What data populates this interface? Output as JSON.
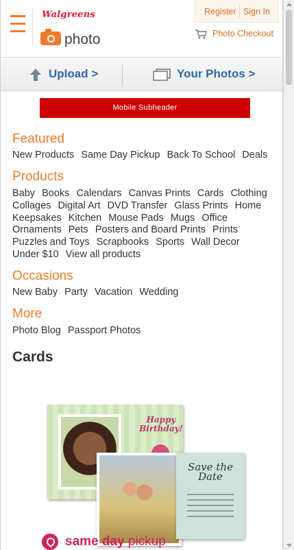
{
  "header": {
    "brand": "Walgreens",
    "product": "photo",
    "register": "Register",
    "sign_in": "Sign In",
    "checkout": "Photo Checkout"
  },
  "actions": {
    "upload": "Upload >",
    "your_photos": "Your Photos >"
  },
  "subheader": "Mobile Subheader",
  "sections": {
    "featured": {
      "title": "Featured",
      "items": [
        "New Products",
        "Same Day Pickup",
        "Back To School",
        "Deals"
      ]
    },
    "products": {
      "title": "Products",
      "items": [
        "Baby",
        "Books",
        "Calendars",
        "Canvas Prints",
        "Cards",
        "Clothing",
        "Collages",
        "Digital Art",
        "DVD Transfer",
        "Glass Prints",
        "Home",
        "Keepsakes",
        "Kitchen",
        "Mouse Pads",
        "Mugs",
        "Office",
        "Ornaments",
        "Pets",
        "Posters and Board Prints",
        "Prints",
        "Puzzles and Toys",
        "Scrapbooks",
        "Sports",
        "Wall Decor",
        "Under $10",
        "View all products"
      ]
    },
    "occasions": {
      "title": "Occasions",
      "items": [
        "New Baby",
        "Party",
        "Vacation",
        "Wedding"
      ]
    },
    "more": {
      "title": "More",
      "items": [
        "Photo Blog",
        "Passport Photos"
      ]
    }
  },
  "cards": {
    "title": "Cards",
    "promo": {
      "birthday_text": "Happy Birthday!",
      "save_the_date": "Save the Date",
      "same_day": "same day",
      "pickup": "pickup"
    }
  },
  "colors": {
    "accent_orange": "#ee7b2a",
    "link_blue": "#2b6ca8",
    "subheader_red": "#cc0000",
    "brand_red": "#e31837",
    "pickup_pink": "#d2215f"
  }
}
